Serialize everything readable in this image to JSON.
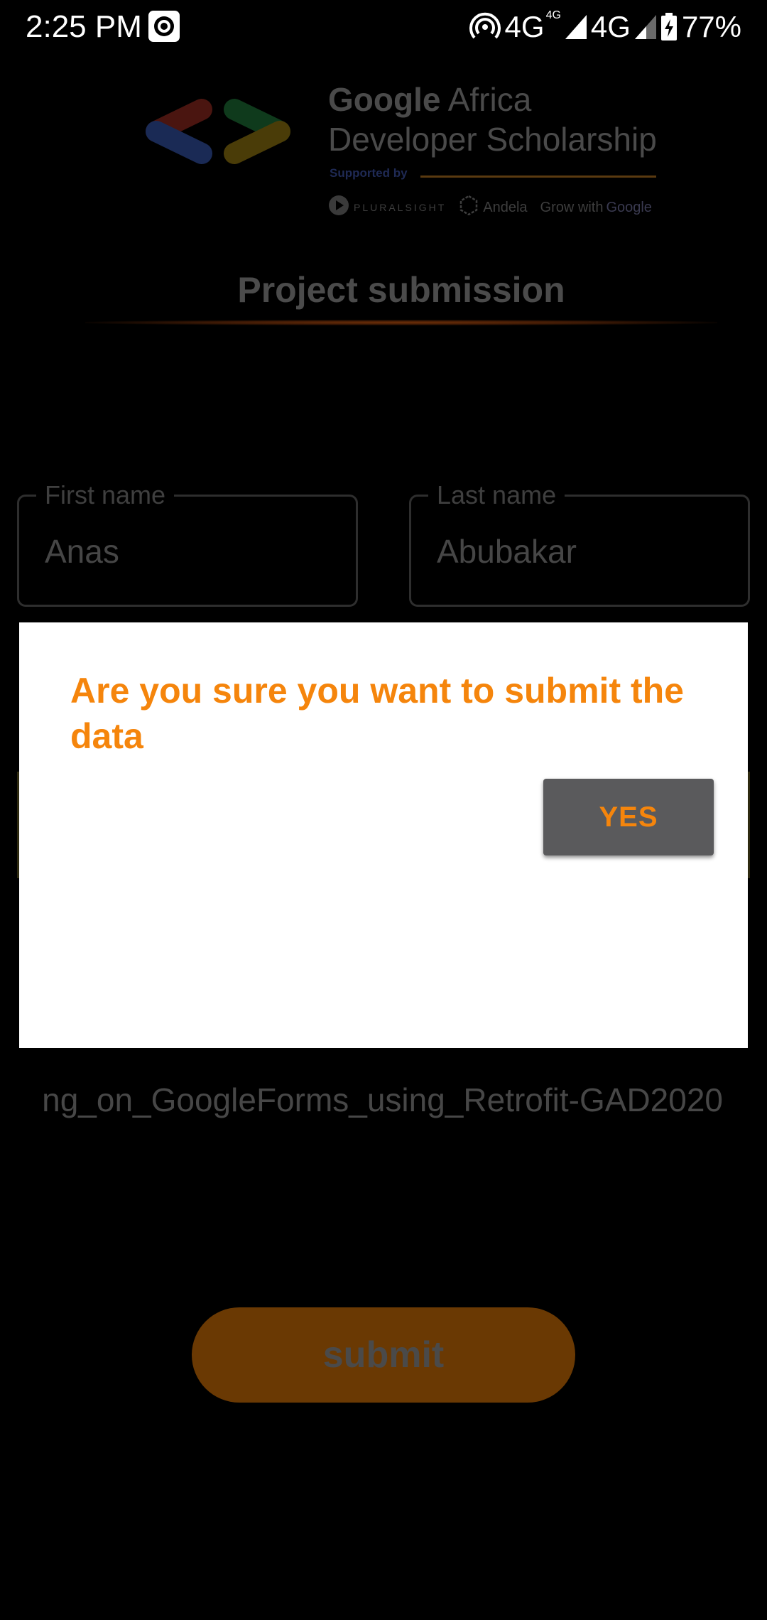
{
  "status_bar": {
    "time": "2:25 PM",
    "network_1": "4G",
    "network_1_sup": "4G",
    "network_2": "4G",
    "battery": "77%",
    "icons": [
      "camera-record-icon",
      "hotspot-icon",
      "signal-icon",
      "signal-weak-icon",
      "battery-charging-icon"
    ]
  },
  "header": {
    "brand_google": "Google",
    "brand_africa": "Africa",
    "brand_line2": "Developer Scholarship",
    "supported_by": "Supported by",
    "partners": {
      "pluralsight": "PLURALSIGHT",
      "andela": "Andela",
      "grow_with": "Grow with",
      "google": "Google"
    }
  },
  "page": {
    "title": "Project submission"
  },
  "form": {
    "first_name": {
      "label": "First name",
      "value": "Anas"
    },
    "last_name": {
      "label": "Last name",
      "value": "Abubakar"
    },
    "url_value": "ng_on_GoogleForms_using_Retrofit-GAD2020",
    "submit_label": "submit"
  },
  "dialog": {
    "message": "Are you sure you want to submit the data",
    "yes_label": "YES"
  },
  "colors": {
    "accent_orange": "#f5850c",
    "dialog_button": "#5a5a5c",
    "submit_dimmed": "#6a3903",
    "background": "#000000"
  }
}
